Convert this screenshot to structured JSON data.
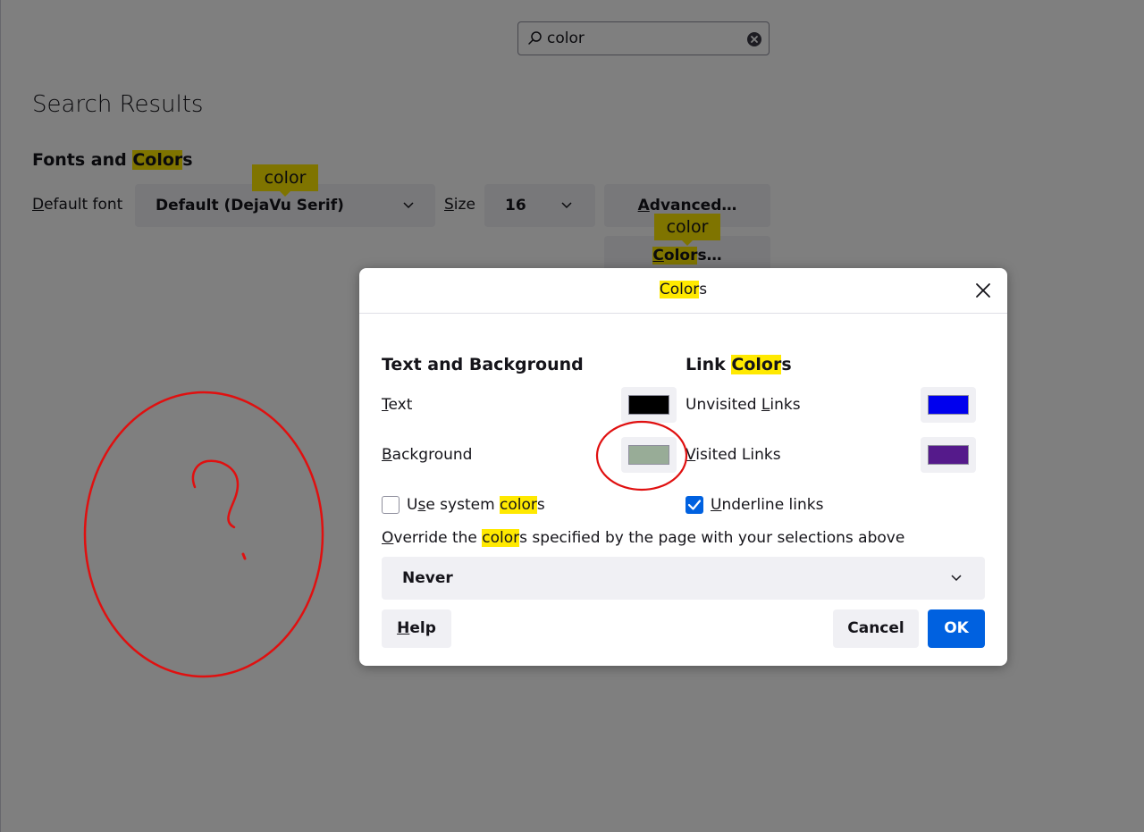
{
  "search": {
    "value": "color"
  },
  "page": {
    "title": "Search Results",
    "section": {
      "title_pre": "Fonts and ",
      "title_hl": "Color",
      "title_post": "s"
    },
    "default_font_label": {
      "ul": "D",
      "rest": "efault font"
    },
    "default_font_value": "Default (DejaVu Serif)",
    "size_label": {
      "ul": "S",
      "rest": "ize"
    },
    "size_value": "16",
    "advanced_button": {
      "ul": "A",
      "rest": "dvanced…"
    },
    "colors_button": {
      "ul": "C",
      "hl": "olor",
      "rest": "s…"
    },
    "tooltip_1": "color",
    "tooltip_2": "color"
  },
  "dialog": {
    "title_hl": "Color",
    "title_rest": "s",
    "text_bg_heading": "Text and Background",
    "link_heading_pre": "Link ",
    "link_heading_hl": "Color",
    "link_heading_post": "s",
    "text_label": {
      "ul": "T",
      "rest": "ext"
    },
    "background_label": {
      "ul": "B",
      "rest": "ackground"
    },
    "unvisited_label": {
      "pre": "Unvisited ",
      "ul": "L",
      "rest": "inks"
    },
    "visited_label": {
      "ul": "V",
      "rest": "isited Links"
    },
    "use_system": {
      "pre": "U",
      "ul": "s",
      "mid": "e system ",
      "hl": "color",
      "post": "s",
      "checked": false
    },
    "underline": {
      "ul": "U",
      "rest": "nderline links",
      "checked": true
    },
    "override": {
      "ul": "O",
      "mid": "verride the ",
      "hl": "color",
      "post": "s specified by the page with your selections above"
    },
    "override_value": "Never",
    "help": {
      "ul": "H",
      "rest": "elp"
    },
    "cancel": "Cancel",
    "ok": "OK"
  },
  "colors": {
    "text": "#000000",
    "background": "#98ac97",
    "unvisited": "#0000ee",
    "visited": "#551a8b",
    "highlight": "#ffe900",
    "accent": "#0061e0",
    "annotation": "#e01010"
  },
  "icons": {
    "search": "search-icon",
    "clear": "clear-icon",
    "chevron": "chevron-down-icon",
    "close": "close-icon",
    "check": "check-icon"
  }
}
